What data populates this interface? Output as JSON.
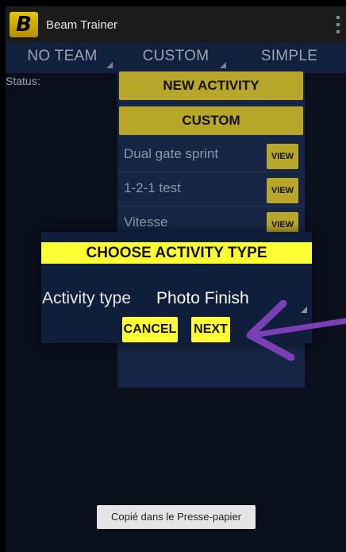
{
  "app": {
    "title": "Beam Trainer",
    "logo_letter": "B"
  },
  "spinners": [
    {
      "label": "NO TEAM"
    },
    {
      "label": "CUSTOM"
    },
    {
      "label": "SIMPLE"
    }
  ],
  "status_label": "Status:",
  "panel": {
    "new_activity_label": "NEW ACTIVITY",
    "custom_label": "CUSTOM",
    "rows": [
      {
        "name": "Dual gate sprint",
        "view_label": "VIEW"
      },
      {
        "name": "1-2-1 test",
        "view_label": "VIEW"
      },
      {
        "name": "Vitesse",
        "view_label": "VIEW"
      }
    ]
  },
  "dialog": {
    "title": "CHOOSE ACTIVITY TYPE",
    "field_label": "Activity type",
    "field_value": "Photo Finish",
    "cancel_label": "CANCEL",
    "next_label": "NEXT"
  },
  "toast": "Copié dans le Presse-papier",
  "colors": {
    "gold": "#b8a62a",
    "dialog_yellow": "#ffff33",
    "annotation_purple": "#7b3fb5"
  }
}
